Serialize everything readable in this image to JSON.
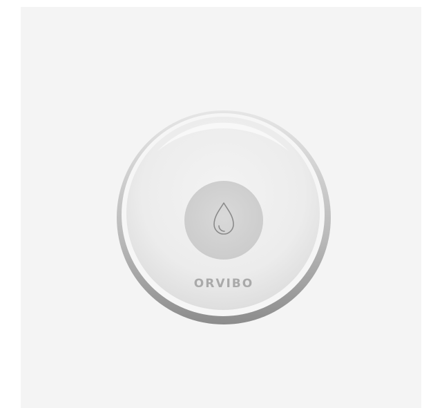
{
  "product": {
    "brand": "ORVIBO",
    "icon": "water-drop-icon"
  },
  "colors": {
    "background": "#f4f4f4",
    "page": "#ffffff",
    "rim": "#9e9e9e",
    "body": "#eeeeee",
    "button": "#d4d4d4",
    "icon": "#8a8a8a",
    "brand_text": "#a9a9a9"
  }
}
